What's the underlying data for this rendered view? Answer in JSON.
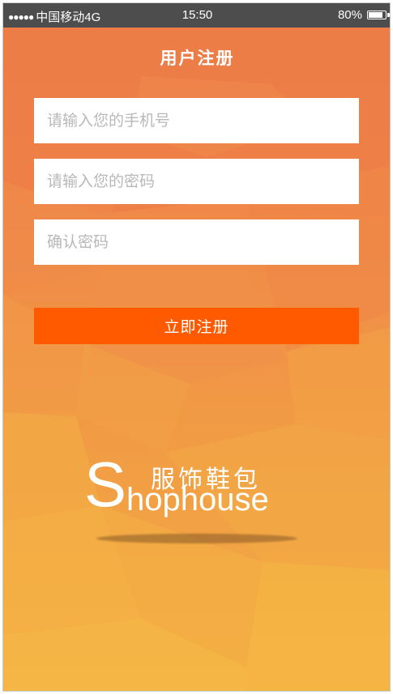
{
  "status_bar": {
    "carrier": "中国移动4G",
    "time": "15:50",
    "battery": "80%",
    "battery_level": 0.8
  },
  "page": {
    "title": "用户注册"
  },
  "form": {
    "phone_placeholder": "请输入您的手机号",
    "password_placeholder": "请输入您的密码",
    "confirm_placeholder": "确认密码",
    "submit_label": "立即注册"
  },
  "brand": {
    "logo_initial": "S",
    "logo_rest": "hophouse",
    "tagline": "服饰鞋包"
  },
  "colors": {
    "accent_button": "#ff5a00",
    "background_top": "#ee7e48",
    "background_bottom": "#f3ad43",
    "status_bar": "#4d4d4d"
  }
}
